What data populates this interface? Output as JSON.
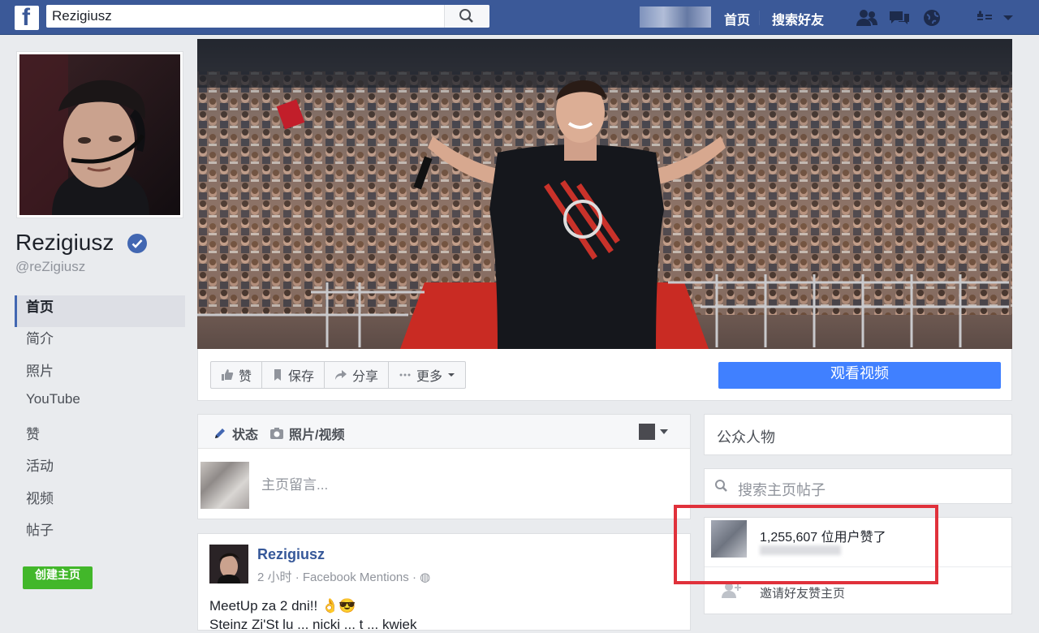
{
  "header": {
    "search_value": "Rezigiusz",
    "nav_home": "首页",
    "nav_find_friends": "搜索好友"
  },
  "profile": {
    "name": "Rezigiusz",
    "handle": "@reZigiusz"
  },
  "sidebar": {
    "items": [
      {
        "label": "首页",
        "active": true
      },
      {
        "label": "简介"
      },
      {
        "label": "照片"
      },
      {
        "label": "YouTube"
      },
      {
        "label": "赞"
      },
      {
        "label": "活动"
      },
      {
        "label": "视频"
      },
      {
        "label": "帖子"
      }
    ],
    "create_page": "创建主页"
  },
  "actions": {
    "like": "赞",
    "save": "保存",
    "share": "分享",
    "more": "更多",
    "watch_video": "观看视频"
  },
  "composer": {
    "tab_status": "状态",
    "tab_photo_video": "照片/视频",
    "placeholder": "主页留言..."
  },
  "post": {
    "author": "Rezigiusz",
    "time": "2 小时",
    "source": "Facebook Mentions",
    "text": "MeetUp za 2 dni!!",
    "text_line2": "Steinz Zi'St lu ... nicki ... t ... kwiek"
  },
  "right": {
    "category": "公众人物",
    "search_placeholder": "搜索主页帖子",
    "likes_text": "1,255,607 位用户赞了",
    "invite_text": "邀请好友赞主页"
  },
  "colors": {
    "brand_blue": "#3b5998",
    "watch_button": "#4080ff",
    "create_button": "#42b72a",
    "highlight_red": "#e0313b"
  }
}
